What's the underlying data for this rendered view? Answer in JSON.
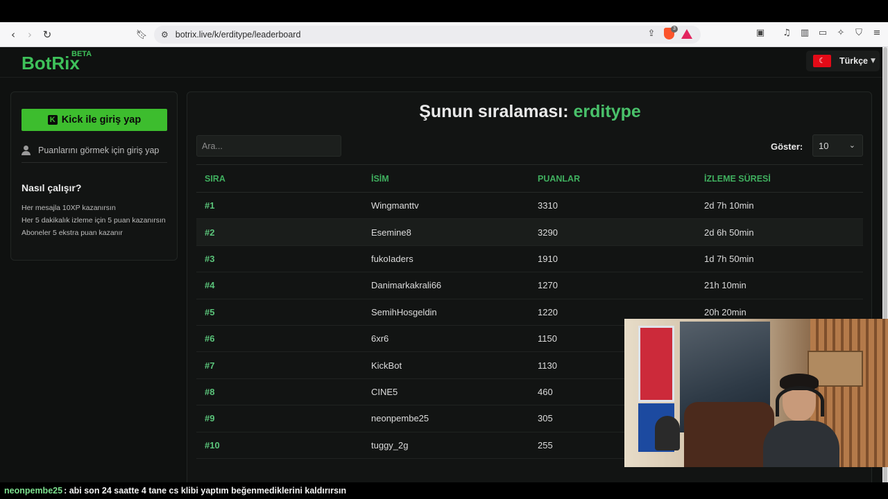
{
  "browser": {
    "url": "botrix.live/k/erditype/leaderboard",
    "brave_badge": "3"
  },
  "header": {
    "logo": "BotRix",
    "logo_badge": "BETA",
    "language": "Türkçe"
  },
  "sidebar": {
    "kick_login": "Kick ile giriş yap",
    "login_hint": "Puanlarını görmek için giriş yap",
    "how_title": "Nasıl çalışır?",
    "how_items": [
      "Her mesajla 10XP kazanırsın",
      "Her 5 dakikalık izleme için 5 puan kazanırsın",
      "Aboneler 5 ekstra puan kazanır"
    ]
  },
  "main": {
    "title_prefix": "Şunun sıralaması:",
    "title_name": "erditype",
    "search_placeholder": "Ara...",
    "show_label": "Göster:",
    "show_value": "10",
    "columns": [
      "SIRA",
      "İSİM",
      "PUANLAR",
      "İZLEME SÜRESİ"
    ],
    "rows": [
      {
        "rank": "#1",
        "name": "Wingmanttv",
        "points": "3310",
        "watch": "2d 7h 10min"
      },
      {
        "rank": "#2",
        "name": "Esemine8",
        "points": "3290",
        "watch": "2d 6h 50min"
      },
      {
        "rank": "#3",
        "name": "fukoIaders",
        "points": "1910",
        "watch": "1d 7h 50min"
      },
      {
        "rank": "#4",
        "name": "Danimarkakrali66",
        "points": "1270",
        "watch": "21h 10min"
      },
      {
        "rank": "#5",
        "name": "SemihHosgeldin",
        "points": "1220",
        "watch": "20h 20min"
      },
      {
        "rank": "#6",
        "name": "6xr6",
        "points": "1150",
        "watch": ""
      },
      {
        "rank": "#7",
        "name": "KickBot",
        "points": "1130",
        "watch": ""
      },
      {
        "rank": "#8",
        "name": "CINE5",
        "points": "460",
        "watch": ""
      },
      {
        "rank": "#9",
        "name": "neonpembe25",
        "points": "305",
        "watch": ""
      },
      {
        "rank": "#10",
        "name": "tuggy_2g",
        "points": "255",
        "watch": ""
      }
    ]
  },
  "chat": {
    "user": "neonpembe25",
    "message": ": abi son 24 saatte 4 tane cs klibi yaptım beğenmediklerini kaldırırsın"
  },
  "colors": {
    "accent": "#3ec15a",
    "kick_green": "#3dbd2e",
    "background": "#0f1110"
  }
}
